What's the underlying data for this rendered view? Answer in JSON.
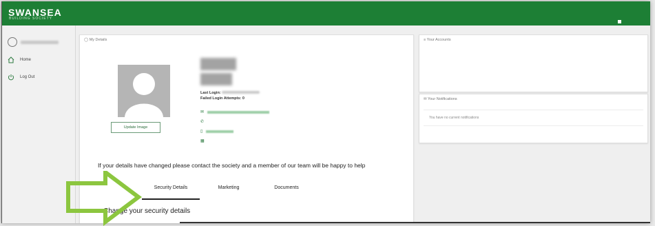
{
  "brand": {
    "name": "SWANSEA",
    "subtitle": "BUILDING SOCIETY",
    "color": "#1d7f35"
  },
  "sidebar": {
    "items": [
      {
        "label": "Home",
        "icon": "home-icon"
      },
      {
        "label": "Log Out",
        "icon": "power-icon"
      }
    ]
  },
  "profile_card": {
    "title": "My Details",
    "update_button": "Update Image",
    "last_login_label": "Last Login:",
    "failed_login_label": "Failed Login Attempts: 0",
    "notice": "If your details have changed please contact the society and a member of our team will be happy to help",
    "tabs": [
      {
        "label": "Security Details",
        "active": true
      },
      {
        "label": "Marketing",
        "active": false
      },
      {
        "label": "Documents",
        "active": false
      }
    ],
    "section_heading": "Change your security details"
  },
  "accounts_card": {
    "title": "Your Accounts"
  },
  "notifications_card": {
    "title": "Your Notifications",
    "empty_text": "You have no current notifications"
  },
  "annotation": {
    "arrow_color": "#8cc63f"
  }
}
